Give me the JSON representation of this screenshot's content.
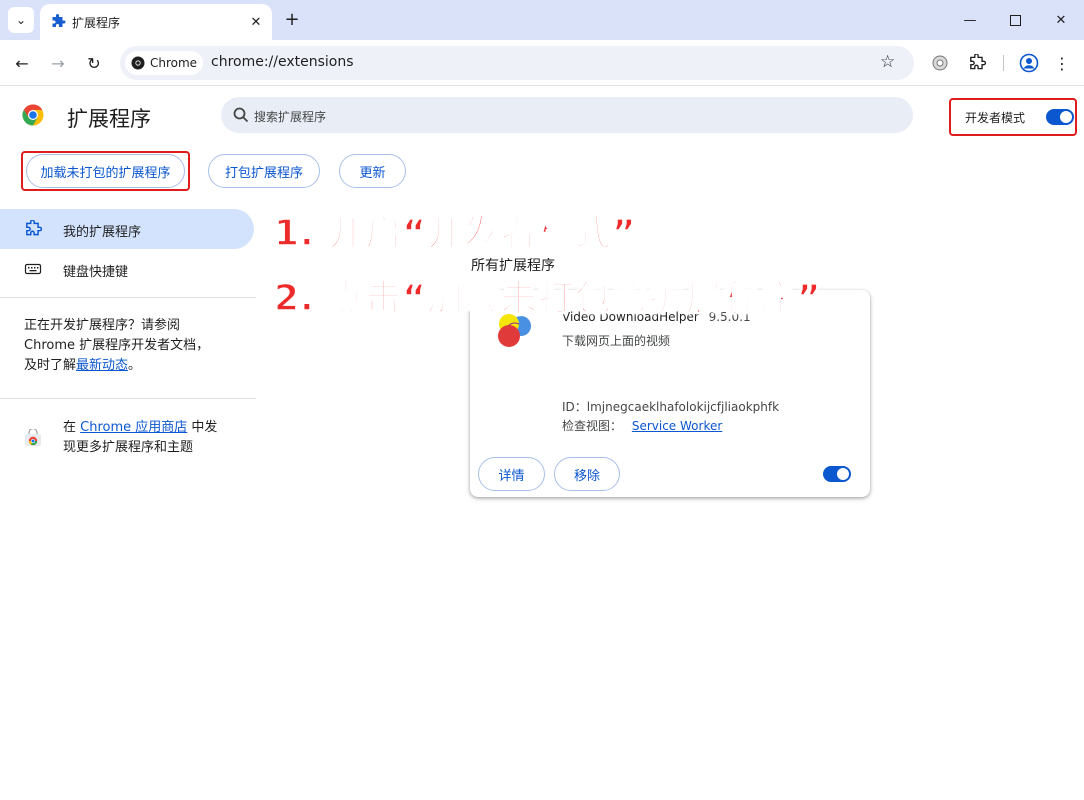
{
  "browser": {
    "tab_title": "扩展程序",
    "chip_label": "Chrome",
    "url": "chrome://extensions"
  },
  "header": {
    "title": "扩展程序",
    "search_placeholder": "搜索扩展程序",
    "dev_mode_label": "开发者模式",
    "dev_mode_on": true
  },
  "actions": {
    "load_unpacked": "加载未打包的扩展程序",
    "pack": "打包扩展程序",
    "update": "更新"
  },
  "sidebar": {
    "items": [
      {
        "label": "我的扩展程序",
        "active": true
      },
      {
        "label": "键盘快捷键",
        "active": false
      }
    ],
    "dev_note_prefix": "正在开发扩展程序？请参阅",
    "dev_note_line2": "Chrome 扩展程序开发者文档，",
    "dev_note_line3_prefix": "及时了解",
    "dev_note_link": "最新动态",
    "dev_note_suffix": "。",
    "store_prefix": "在 ",
    "store_link": "Chrome 应用商店",
    "store_suffix": " 中发",
    "store_line2": "现更多扩展程序和主题"
  },
  "section_title": "所有扩展程序",
  "extension": {
    "name": "Video DownloadHelper",
    "version": "9.5.0.1",
    "description": "下载网页上面的视频",
    "id_label": "ID：",
    "id": "lmjnegcaeklhafolokijcfjliaokphfk",
    "inspect_label": "检查视图：",
    "inspect_link": "Service Worker",
    "details_button": "详情",
    "remove_button": "移除",
    "enabled": true
  },
  "annotations": {
    "step1": "1. 开启“开发者模式”",
    "step2": "2. 点击“加载未打包的扩展程序”"
  },
  "colors": {
    "accent": "#0b57d0",
    "highlight": "#e01d1d",
    "annotation": "#ee2b2b"
  }
}
